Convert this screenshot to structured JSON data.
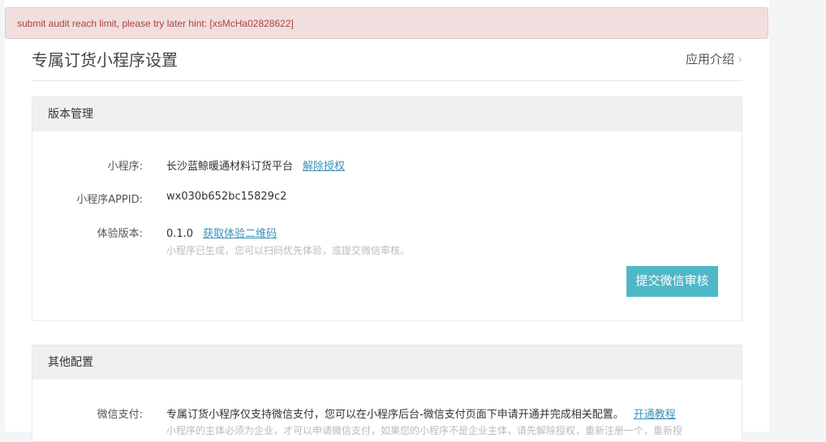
{
  "alert": {
    "message": "submit audit reach limit, please try later hint: [xsMcHa02828622]"
  },
  "header": {
    "title": "专属订货小程序设置",
    "intro_link": "应用介绍",
    "chevron": "›"
  },
  "version_card": {
    "title": "版本管理",
    "mini_program_label": "小程序:",
    "mini_program_value": "长沙蓝鲸暖通材料订货平台",
    "unbind_link": "解除授权",
    "appid_label": "小程序APPID:",
    "appid_value": "wx030b652bc15829c2",
    "trial_label": "体验版本:",
    "trial_value": "0.1.0",
    "qrcode_link": "获取体验二维码",
    "trial_hint": "小程序已生成，您可以扫码优先体验，或提交微信审核。",
    "submit_button": "提交微信审核"
  },
  "other_card": {
    "title": "其他配置",
    "pay_label": "微信支付:",
    "pay_value": "专属订货小程序仅支持微信支付，您可以在小程序后台-微信支付页面下申请开通并完成相关配置。",
    "tutorial_link": "开通教程",
    "pay_hint": "小程序的主体必须为企业，才可以申请微信支付，如果您的小程序不是企业主体，请先解除授权，重新注册一个，重新授"
  }
}
